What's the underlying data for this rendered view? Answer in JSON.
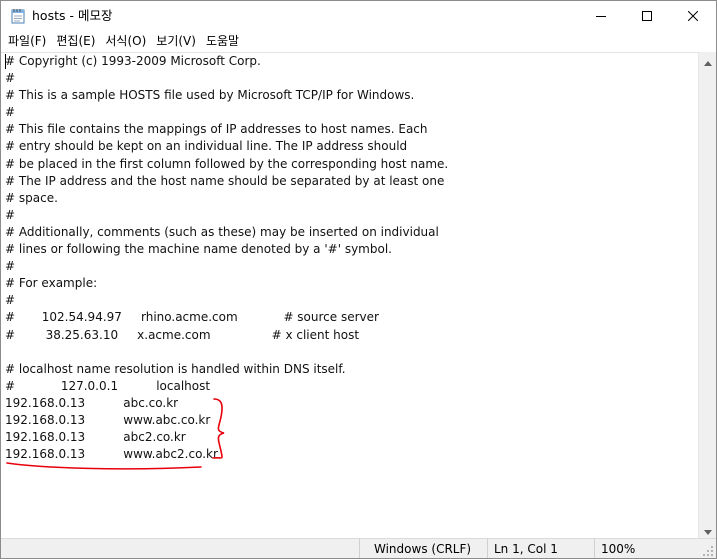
{
  "window": {
    "title": "hosts - 메모장",
    "app_icon": "notepad-icon",
    "buttons": {
      "minimize": "minimize-icon",
      "maximize": "maximize-icon",
      "close": "close-icon"
    }
  },
  "menu": {
    "items": [
      {
        "label": "파일(F)"
      },
      {
        "label": "편집(E)"
      },
      {
        "label": "서식(O)"
      },
      {
        "label": "보기(V)"
      },
      {
        "label": "도움말"
      }
    ]
  },
  "editor": {
    "content": "# Copyright (c) 1993-2009 Microsoft Corp.\n#\n# This is a sample HOSTS file used by Microsoft TCP/IP for Windows.\n#\n# This file contains the mappings of IP addresses to host names. Each\n# entry should be kept on an individual line. The IP address should\n# be placed in the first column followed by the corresponding host name.\n# The IP address and the host name should be separated by at least one\n# space.\n#\n# Additionally, comments (such as these) may be inserted on individual\n# lines or following the machine name denoted by a '#' symbol.\n#\n# For example:\n#\n#       102.54.94.97     rhino.acme.com            # source server\n#        38.25.63.10     x.acme.com                # x client host\n\n# localhost name resolution is handled within DNS itself.\n#            127.0.0.1          localhost\n192.168.0.13          abc.co.kr\n192.168.0.13          www.abc.co.kr\n192.168.0.13          abc2.co.kr\n192.168.0.13          www.abc2.co.kr",
    "annotation_color": "#e8000b"
  },
  "statusbar": {
    "encoding": "Windows (CRLF)",
    "position": "Ln 1, Col 1",
    "zoom": "100%"
  }
}
